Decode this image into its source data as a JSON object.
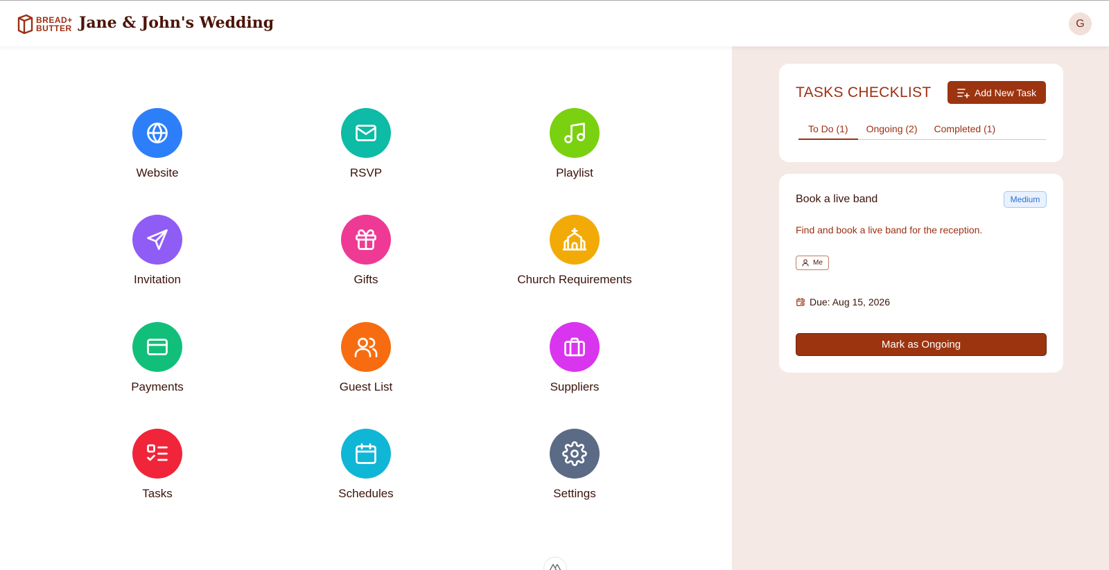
{
  "header": {
    "logo_line1": "BREAD+",
    "logo_line2": "BUTTER",
    "title": "Jane & John's Wedding",
    "avatar_initial": "G"
  },
  "apps": [
    {
      "label": "Website",
      "color": "#2d7ff9",
      "icon": "globe-icon"
    },
    {
      "label": "RSVP",
      "color": "#0dbba6",
      "icon": "mail-icon"
    },
    {
      "label": "Playlist",
      "color": "#7ad10f",
      "icon": "music-icon"
    },
    {
      "label": "Invitation",
      "color": "#8f5cf5",
      "icon": "send-icon"
    },
    {
      "label": "Gifts",
      "color": "#ee3a95",
      "icon": "gift-icon"
    },
    {
      "label": "Church Requirements",
      "color": "#f2aa07",
      "icon": "church-icon"
    },
    {
      "label": "Payments",
      "color": "#12bf7a",
      "icon": "credit-card-icon"
    },
    {
      "label": "Guest List",
      "color": "#f76c10",
      "icon": "users-icon"
    },
    {
      "label": "Suppliers",
      "color": "#d935ee",
      "icon": "briefcase-icon"
    },
    {
      "label": "Tasks",
      "color": "#f0253a",
      "icon": "checklist-icon"
    },
    {
      "label": "Schedules",
      "color": "#10b6d6",
      "icon": "calendar-icon"
    },
    {
      "label": "Settings",
      "color": "#5b6b86",
      "icon": "gear-icon"
    }
  ],
  "tasks": {
    "title": "TASKS CHECKLIST",
    "add_label": "Add New Task",
    "tabs": [
      "To Do (1)",
      "Ongoing (2)",
      "Completed (1)"
    ],
    "active_tab": 0,
    "item": {
      "name": "Book a live band",
      "priority": "Medium",
      "description": "Find and book a live band for the reception.",
      "assignee": "Me",
      "due": "Due: Aug 15, 2026",
      "action_label": "Mark as Ongoing"
    }
  },
  "colors": {
    "brand": "#9c3410",
    "sidebar_bg": "#f5e9e5"
  }
}
